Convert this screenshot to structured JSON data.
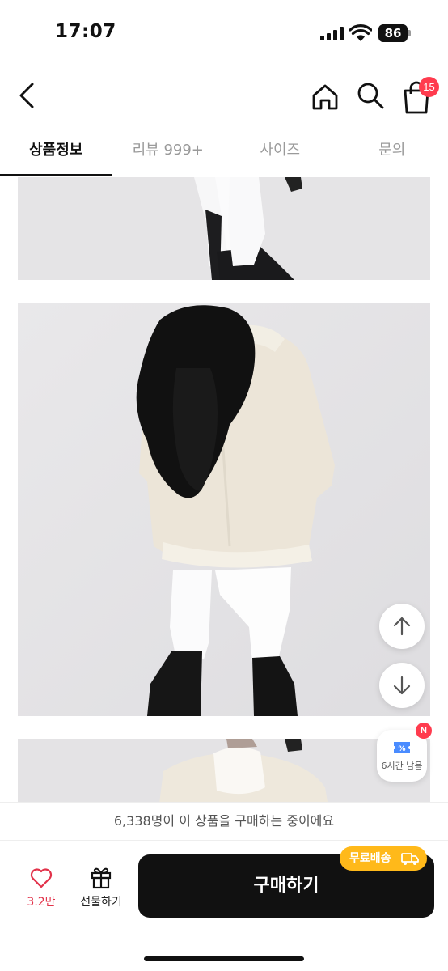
{
  "status_bar": {
    "time": "17:07",
    "battery": "86"
  },
  "header": {
    "cart_count": "15"
  },
  "tabs": [
    {
      "label": "상품정보",
      "active": true
    },
    {
      "label": "리뷰 999+",
      "active": false
    },
    {
      "label": "사이즈",
      "active": false
    },
    {
      "label": "문의",
      "active": false
    }
  ],
  "coupon": {
    "timer_text": "6시간 남음",
    "badge": "N"
  },
  "buyers_banner": "6,338명이 이 상품을 구매하는 중이에요",
  "bottom_bar": {
    "like_count": "3.2만",
    "gift_label": "선물하기",
    "buy_label": "구매하기",
    "free_shipping_label": "무료배송"
  },
  "colors": {
    "accent_red": "#ff3b4e",
    "shipping_badge": "#ffb91a",
    "buy_button": "#111111"
  }
}
